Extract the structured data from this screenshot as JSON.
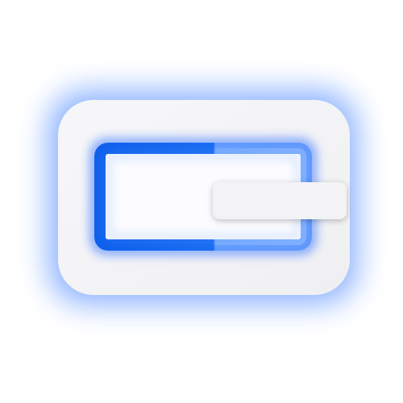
{
  "icon": {
    "name": "window-app-icon",
    "colors": {
      "page_background": "#ffffff",
      "body_fill": "#f4f4f6",
      "glow": "#2a6cff",
      "frame_stroke": "#1467f0",
      "frame_stroke_light": "#3d8bff",
      "inner_fill": "#fdfdfe",
      "tab_fill": "#f2f2f4"
    }
  }
}
